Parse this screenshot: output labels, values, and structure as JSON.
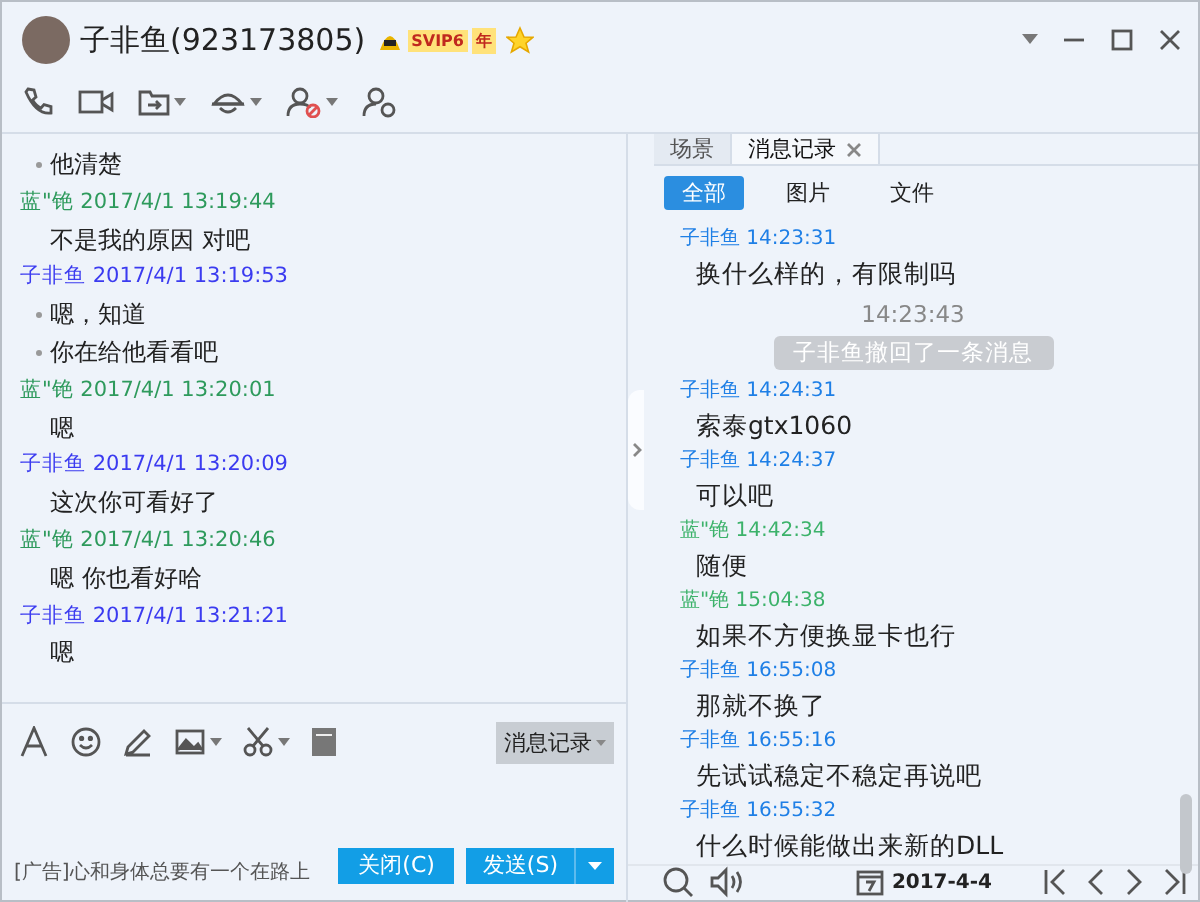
{
  "window": {
    "title": "子非鱼(923173805)",
    "vip_badge": "SVIP6",
    "year_badge": "年"
  },
  "chat_log": [
    {
      "kind": "message",
      "text": "他清楚",
      "bullet": true
    },
    {
      "kind": "header",
      "sender": "蓝\"铯",
      "time": "2017/4/1 13:19:44",
      "color": "#2e9a5c"
    },
    {
      "kind": "message",
      "text": "不是我的原因 对吧",
      "bullet": false
    },
    {
      "kind": "header",
      "sender": "子非鱼",
      "time": "2017/4/1 13:19:53",
      "color": "#3b3bf0"
    },
    {
      "kind": "message",
      "text": "嗯，知道",
      "bullet": true
    },
    {
      "kind": "message",
      "text": "你在给他看看吧",
      "bullet": true
    },
    {
      "kind": "header",
      "sender": "蓝\"铯",
      "time": "2017/4/1 13:20:01",
      "color": "#2e9a5c"
    },
    {
      "kind": "message",
      "text": "嗯",
      "bullet": false
    },
    {
      "kind": "header",
      "sender": "子非鱼",
      "time": "2017/4/1 13:20:09",
      "color": "#3b3bf0"
    },
    {
      "kind": "message",
      "text": "这次你可看好了",
      "bullet": false
    },
    {
      "kind": "header",
      "sender": "蓝\"铯",
      "time": "2017/4/1 13:20:46",
      "color": "#2e9a5c"
    },
    {
      "kind": "message",
      "text": "嗯 你也看好哈",
      "bullet": false
    },
    {
      "kind": "header",
      "sender": "子非鱼",
      "time": "2017/4/1 13:21:21",
      "color": "#3b3bf0"
    },
    {
      "kind": "message",
      "text": "嗯",
      "bullet": false
    }
  ],
  "composer": {
    "history_button": "消息记录",
    "ad": "[广告]心和身体总要有一个在路上",
    "close_button": "关闭(C)",
    "send_button": "发送(S)"
  },
  "side_tabs": [
    {
      "label": "场景",
      "selected": false,
      "closable": false
    },
    {
      "label": "消息记录",
      "selected": true,
      "closable": true
    }
  ],
  "filters": [
    {
      "label": "全部",
      "selected": true
    },
    {
      "label": "图片",
      "selected": false
    },
    {
      "label": "文件",
      "selected": false
    }
  ],
  "history": [
    {
      "kind": "header",
      "sender": "子非鱼",
      "time": "14:23:31",
      "color": "#1e7fe6"
    },
    {
      "kind": "message",
      "text": "换什么样的，有限制吗"
    },
    {
      "kind": "notice",
      "time": "14:23:43",
      "text": "子非鱼撤回了一条消息"
    },
    {
      "kind": "header",
      "sender": "子非鱼",
      "time": "14:24:31",
      "color": "#1e7fe6"
    },
    {
      "kind": "message",
      "text": "索泰gtx1060"
    },
    {
      "kind": "header",
      "sender": "子非鱼",
      "time": "14:24:37",
      "color": "#1e7fe6"
    },
    {
      "kind": "message",
      "text": "可以吧"
    },
    {
      "kind": "header",
      "sender": "蓝\"铯",
      "time": "14:42:34",
      "color": "#3cb26a"
    },
    {
      "kind": "message",
      "text": "随便"
    },
    {
      "kind": "header",
      "sender": "蓝\"铯",
      "time": "15:04:38",
      "color": "#3cb26a"
    },
    {
      "kind": "message",
      "text": "如果不方便换显卡也行"
    },
    {
      "kind": "header",
      "sender": "子非鱼",
      "time": "16:55:08",
      "color": "#1e7fe6"
    },
    {
      "kind": "message",
      "text": "那就不换了"
    },
    {
      "kind": "header",
      "sender": "子非鱼",
      "time": "16:55:16",
      "color": "#1e7fe6"
    },
    {
      "kind": "message",
      "text": "先试试稳定不稳定再说吧"
    },
    {
      "kind": "header",
      "sender": "子非鱼",
      "time": "16:55:32",
      "color": "#1e7fe6"
    },
    {
      "kind": "message",
      "text": "什么时候能做出来新的DLL"
    }
  ],
  "history_footer": {
    "date": "2017-4-4"
  }
}
